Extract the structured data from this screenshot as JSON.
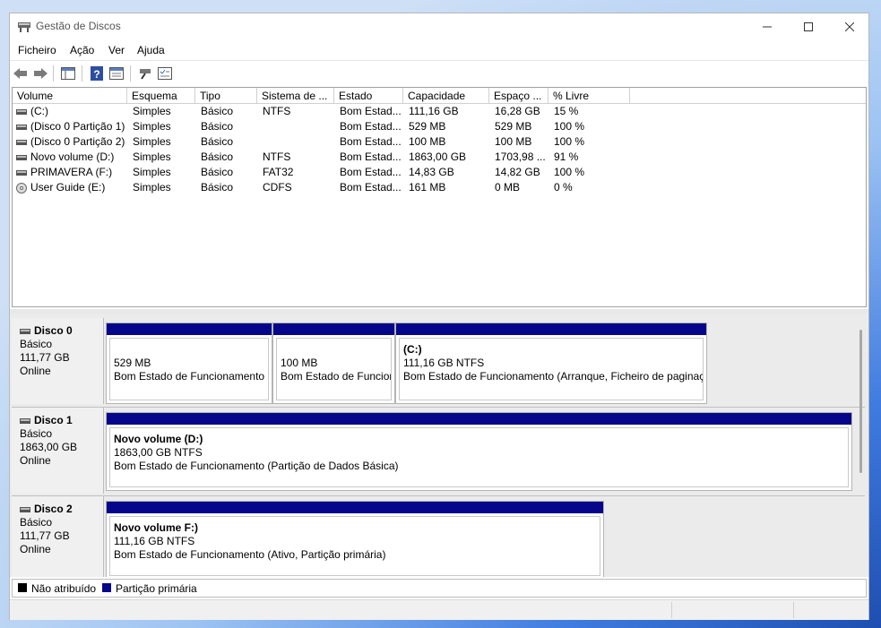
{
  "window": {
    "title": "Gestão de Discos"
  },
  "menu": [
    "Ficheiro",
    "Ação",
    "Ver",
    "Ajuda"
  ],
  "columns": [
    "Volume",
    "Esquema",
    "Tipo",
    "Sistema de ...",
    "Estado",
    "Capacidade",
    "Espaço ...",
    "% Livre"
  ],
  "volumes": [
    {
      "volume": " (C:)",
      "esquema": "Simples",
      "tipo": "Básico",
      "fs": "NTFS",
      "estado": "Bom Estad...",
      "cap": "111,16 GB",
      "livre": "16,28 GB",
      "pct": "15 %",
      "icon": "drive-icon"
    },
    {
      "volume": "(Disco 0 Partição 1)",
      "esquema": "Simples",
      "tipo": "Básico",
      "fs": "",
      "estado": "Bom Estad...",
      "cap": "529 MB",
      "livre": "529 MB",
      "pct": "100 %",
      "icon": "drive-icon"
    },
    {
      "volume": "(Disco 0 Partição 2)",
      "esquema": "Simples",
      "tipo": "Básico",
      "fs": "",
      "estado": "Bom Estad...",
      "cap": "100 MB",
      "livre": "100 MB",
      "pct": "100 %",
      "icon": "drive-icon"
    },
    {
      "volume": "Novo volume (D:)",
      "esquema": "Simples",
      "tipo": "Básico",
      "fs": "NTFS",
      "estado": "Bom Estad...",
      "cap": "1863,00 GB",
      "livre": "1703,98 ...",
      "pct": "91 %",
      "icon": "drive-icon"
    },
    {
      "volume": "PRIMAVERA (F:)",
      "esquema": "Simples",
      "tipo": "Básico",
      "fs": "FAT32",
      "estado": "Bom Estad...",
      "cap": "14,83 GB",
      "livre": "14,82 GB",
      "pct": "100 %",
      "icon": "drive-icon"
    },
    {
      "volume": "User Guide (E:)",
      "esquema": "Simples",
      "tipo": "Básico",
      "fs": "CDFS",
      "estado": "Bom Estad...",
      "cap": "161 MB",
      "livre": "0 MB",
      "pct": "0 %",
      "icon": "cd-icon"
    }
  ],
  "disks": [
    {
      "name": "Disco 0",
      "type": "Básico",
      "size": "111,77 GB",
      "status": "Online",
      "parts": [
        {
          "title": "",
          "line1": "529 MB",
          "line2": "Bom Estado de Funcionamento"
        },
        {
          "title": "",
          "line1": "100 MB",
          "line2": "Bom Estado de Funcionamento"
        },
        {
          "title": " (C:)",
          "line1": "111,16 GB NTFS",
          "line2": "Bom Estado de Funcionamento (Arranque, Ficheiro de paginação"
        }
      ]
    },
    {
      "name": "Disco 1",
      "type": "Básico",
      "size": "1863,00 GB",
      "status": "Online",
      "parts": [
        {
          "title": "Novo volume  (D:)",
          "line1": "1863,00 GB NTFS",
          "line2": "Bom Estado de Funcionamento (Partição de Dados Básica)"
        }
      ]
    },
    {
      "name": "Disco 2",
      "type": "Básico",
      "size": "111,77 GB",
      "status": "Online",
      "parts": [
        {
          "title": "Novo volume F:)",
          "line1": "111,16 GB NTFS",
          "line2": "Bom Estado de Funcionamento (Ativo, Partição primária)"
        }
      ]
    }
  ],
  "legend": {
    "unallocated": "Não atribuído",
    "primary": "Partição primária"
  },
  "colors": {
    "primary_partition": "#05068a",
    "unallocated": "#000000"
  }
}
